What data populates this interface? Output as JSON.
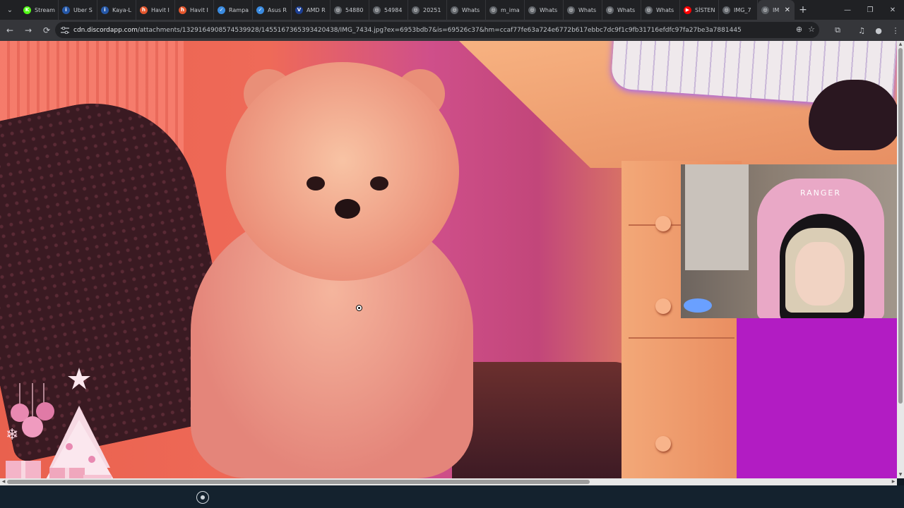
{
  "tabstrip": {
    "menu_icon": "chevron-down-icon",
    "tabs": [
      {
        "label": "Stream",
        "icon": "kick-icon",
        "color": "#53fc18"
      },
      {
        "label": "Uber S",
        "icon": "indeed-icon",
        "color": "#2557a7"
      },
      {
        "label": "Kaya-L",
        "icon": "indeed-icon",
        "color": "#2557a7"
      },
      {
        "label": "Havit I",
        "icon": "havit-icon",
        "color": "#e4572e"
      },
      {
        "label": "Havit I",
        "icon": "havit-icon",
        "color": "#e4572e"
      },
      {
        "label": "Rampa",
        "icon": "check-icon",
        "color": "#3a8be0"
      },
      {
        "label": "Asus R",
        "icon": "check-icon",
        "color": "#3a8be0"
      },
      {
        "label": "AMD R",
        "icon": "v-icon",
        "color": "#1c3f94"
      },
      {
        "label": "54880",
        "icon": "globe-icon",
        "color": "#5f6368"
      },
      {
        "label": "54984",
        "icon": "globe-icon",
        "color": "#5f6368"
      },
      {
        "label": "20251",
        "icon": "globe-icon",
        "color": "#5f6368"
      },
      {
        "label": "Whats",
        "icon": "globe-icon",
        "color": "#5f6368"
      },
      {
        "label": "m_ima",
        "icon": "globe-icon",
        "color": "#5f6368"
      },
      {
        "label": "Whats",
        "icon": "globe-icon",
        "color": "#5f6368"
      },
      {
        "label": "Whats",
        "icon": "globe-icon",
        "color": "#5f6368"
      },
      {
        "label": "Whats",
        "icon": "globe-icon",
        "color": "#5f6368"
      },
      {
        "label": "Whats",
        "icon": "globe-icon",
        "color": "#5f6368"
      },
      {
        "label": "SİSTEN",
        "icon": "youtube-icon",
        "color": "#ff0000"
      },
      {
        "label": "IMG_7",
        "icon": "globe-icon",
        "color": "#5f6368"
      },
      {
        "label": "IM",
        "icon": "globe-icon",
        "color": "#5f6368",
        "active": true
      }
    ],
    "new_tab": "+",
    "window_controls": {
      "minimize": "—",
      "restore": "❐",
      "close": "✕"
    }
  },
  "toolbar": {
    "back": "←",
    "forward": "→",
    "reload": "⟳",
    "url_host": "cdn.discordapp.com",
    "url_path": "/attachments/1329164908574539928/1455167365393420438/IMG_7434.jpg?ex=6953bdb7&is=69526c37&hm=ccaf77fe63a724e6772b617ebbc7dc9f1c9fb31716efdfc97fa27be3a7881445",
    "zoom_icon": "zoom-icon",
    "bookmark_icon": "star-icon",
    "extensions_icon": "puzzle-icon",
    "media_icon": "media-icon",
    "profile_icon": "profile-icon",
    "menu_icon": "kebab-menu-icon"
  },
  "webcam": {
    "chair_brand": "RANGER"
  },
  "colors": {
    "chrome_dark": "#202124",
    "chrome_toolbar": "#35363a",
    "overlay_magenta": "#b21cc3",
    "bottom_bar": "#14222e"
  },
  "scrollbars": {
    "vertical_thumb_fraction": 0.84,
    "horizontal_thumb_fraction": 0.66
  }
}
